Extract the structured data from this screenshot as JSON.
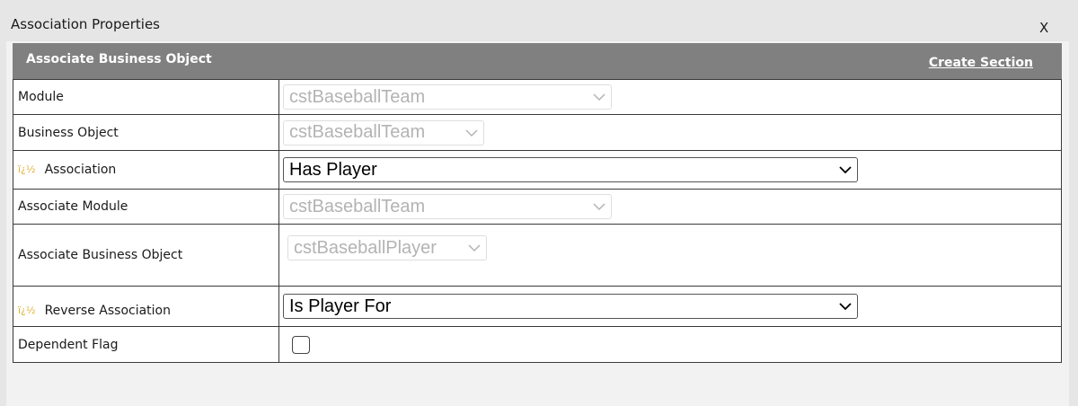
{
  "window": {
    "title": "Association Properties",
    "close_label": "X"
  },
  "section": {
    "title": "Associate Business Object",
    "create_link": "Create Section"
  },
  "rows": {
    "module": {
      "label": "Module",
      "value": "cstBaseballTeam"
    },
    "business_object": {
      "label": "Business Object",
      "value": "cstBaseballTeam"
    },
    "association": {
      "icon": "ï¿½",
      "label": "Association",
      "value": "Has Player"
    },
    "associate_module": {
      "label": "Associate Module",
      "value": "cstBaseballTeam"
    },
    "associate_business_object": {
      "label": "Associate Business Object",
      "value": "cstBaseballPlayer"
    },
    "reverse_association": {
      "icon": "ï¿½",
      "label": "Reverse Association",
      "value": "Is Player For"
    },
    "dependent_flag": {
      "label": "Dependent Flag",
      "checked": false
    }
  }
}
